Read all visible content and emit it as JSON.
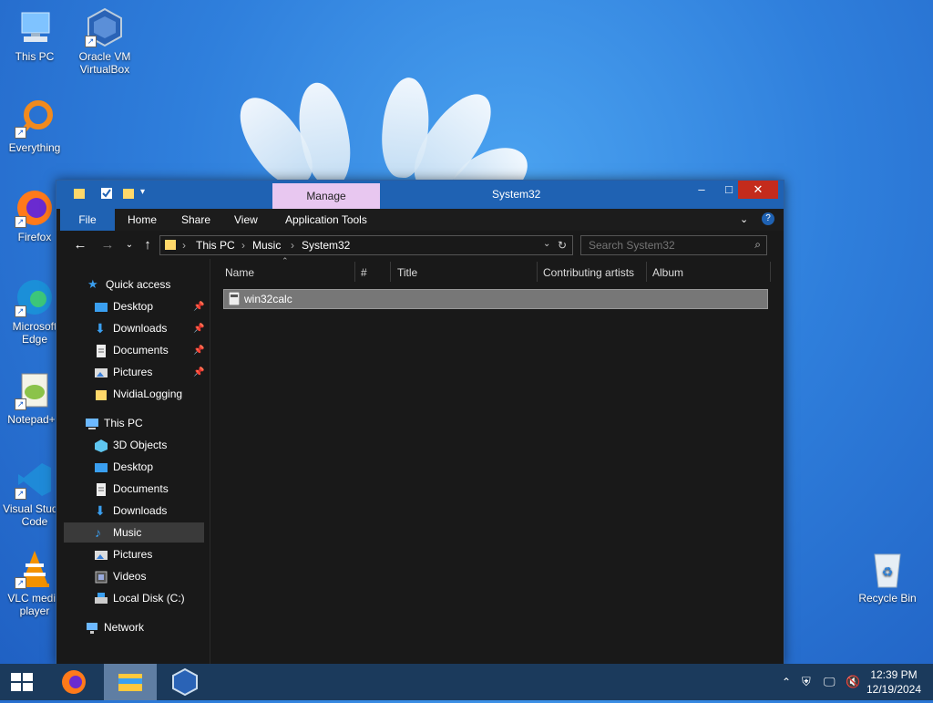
{
  "desktop": {
    "icons": [
      {
        "label": "This PC"
      },
      {
        "label": "Oracle VM VirtualBox"
      },
      {
        "label": "Everything"
      },
      {
        "label": "Firefox"
      },
      {
        "label": "Microsoft Edge"
      },
      {
        "label": "Notepad++"
      },
      {
        "label": "Visual Studio Code"
      },
      {
        "label": "VLC media player"
      },
      {
        "label": "Recycle Bin"
      }
    ]
  },
  "window": {
    "title": "System32",
    "context_tab": "Manage",
    "ribbon_tabs": [
      "File",
      "Home",
      "Share",
      "View",
      "Application Tools"
    ],
    "address": {
      "crumbs": [
        "This PC",
        "Music",
        "System32"
      ]
    },
    "search": {
      "placeholder": "Search System32"
    },
    "nav": {
      "quick_access": "Quick access",
      "quick_items": [
        "Desktop",
        "Downloads",
        "Documents",
        "Pictures",
        "NvidiaLogging"
      ],
      "this_pc": "This PC",
      "pc_items": [
        "3D Objects",
        "Desktop",
        "Documents",
        "Downloads",
        "Music",
        "Pictures",
        "Videos",
        "Local Disk (C:)"
      ],
      "network": "Network",
      "selected": "Music"
    },
    "columns": [
      "Name",
      "#",
      "Title",
      "Contributing artists",
      "Album"
    ],
    "files": [
      {
        "name": "win32calc"
      }
    ]
  },
  "taskbar": {
    "time": "12:39 PM",
    "date": "12/19/2024"
  },
  "colors": {
    "titlebar": "#1f62b3",
    "manage_tab": "#e8c7f0",
    "close_button": "#c42b1c",
    "taskbar": "#1b3a5c"
  }
}
